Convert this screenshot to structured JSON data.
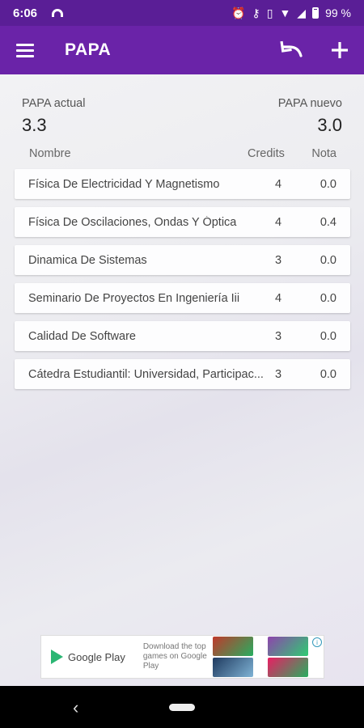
{
  "status_bar": {
    "time": "6:06",
    "battery": "99 %",
    "icons": [
      "alarm-icon",
      "key-icon",
      "vibrate-icon",
      "wifi-icon",
      "signal-icon",
      "battery-icon"
    ]
  },
  "app_bar": {
    "title": "PAPA",
    "color": "#6a23a8",
    "actions": [
      "undo-icon",
      "add-icon"
    ]
  },
  "summary": {
    "current_label": "PAPA actual",
    "current_value": "3.3",
    "new_label": "PAPA nuevo",
    "new_value": "3.0"
  },
  "table": {
    "headers": {
      "name": "Nombre",
      "credits": "Credits",
      "grade": "Nota"
    },
    "rows": [
      {
        "name": "Física De Electricidad Y Magnetismo",
        "credits": "4",
        "grade": "0.0"
      },
      {
        "name": "Física De Oscilaciones, Ondas Y Óptica",
        "credits": "4",
        "grade": "0.4"
      },
      {
        "name": "Dinamica De Sistemas",
        "credits": "3",
        "grade": "0.0"
      },
      {
        "name": "Seminario De Proyectos En Ingeniería Iii",
        "credits": "4",
        "grade": "0.0"
      },
      {
        "name": "Calidad De Software",
        "credits": "3",
        "grade": "0.0"
      },
      {
        "name": "Cátedra Estudiantil: Universidad, Participac...",
        "credits": "3",
        "grade": "0.0"
      }
    ]
  },
  "ad": {
    "brand": "Google Play",
    "text": "Download the top games on Google Play"
  },
  "nav_bar": {
    "back_icon": "back-icon",
    "home_icon": "home-pill-icon"
  }
}
